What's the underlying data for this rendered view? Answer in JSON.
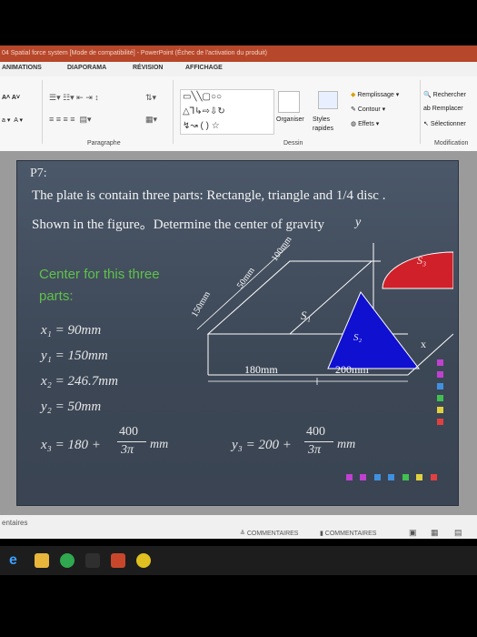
{
  "window": {
    "title": "04 Spatial force system [Mode de compatibilité] - PowerPoint (Échec de l'activation du produit)"
  },
  "ribbon_tabs": [
    "ANIMATIONS",
    "DIAPORAMA",
    "RÉVISION",
    "AFFICHAGE"
  ],
  "ribbon": {
    "paragraphe": "Paragraphe",
    "dessin": "Dessin",
    "modification": "Modification",
    "organiser": "Organiser",
    "styles": "Styles",
    "rapides": "rapides",
    "remplissage": "Remplissage",
    "contour": "Contour",
    "effets": "Effets",
    "rechercher": "Rechercher",
    "remplacer": "Remplacer",
    "selectionner": "Sélectionner"
  },
  "slide": {
    "number": "P7:",
    "line1": "The plate is contain three parts: Rectangle,  triangle and 1/4 disc .",
    "line2": "Shown in the figure。Determine the center of gravity",
    "center_title1": "Center for this three",
    "center_title2": "parts:",
    "eq_x1": "x₁ = 90mm",
    "eq_y1": "y₁ = 150mm",
    "eq_x2": "x₂ = 246.7mm",
    "eq_y2": "y₂ = 50mm",
    "eq_x3_prefix": "x₃ = 180 +",
    "eq_y3_prefix": "y₃ = 200 +",
    "frac_num": "400",
    "frac_den": "3π",
    "unit": "mm",
    "fig": {
      "y_axis": "y",
      "x_axis": "x",
      "s1": "S₁",
      "s2": "S₂",
      "s3": "S₃",
      "dim_180": "180mm",
      "dim_200": "200mm",
      "dim_150": "150mm",
      "dim_50": "50mm",
      "dim_100": "100mm"
    },
    "colors": {
      "triangle": "#1010d0",
      "disc": "#d0202a",
      "green_text": "#5fc24a"
    }
  },
  "statusbar": {
    "left": "entaires",
    "comments1": "COMMENTAIRES",
    "comments2": "COMMENTAIRES"
  }
}
